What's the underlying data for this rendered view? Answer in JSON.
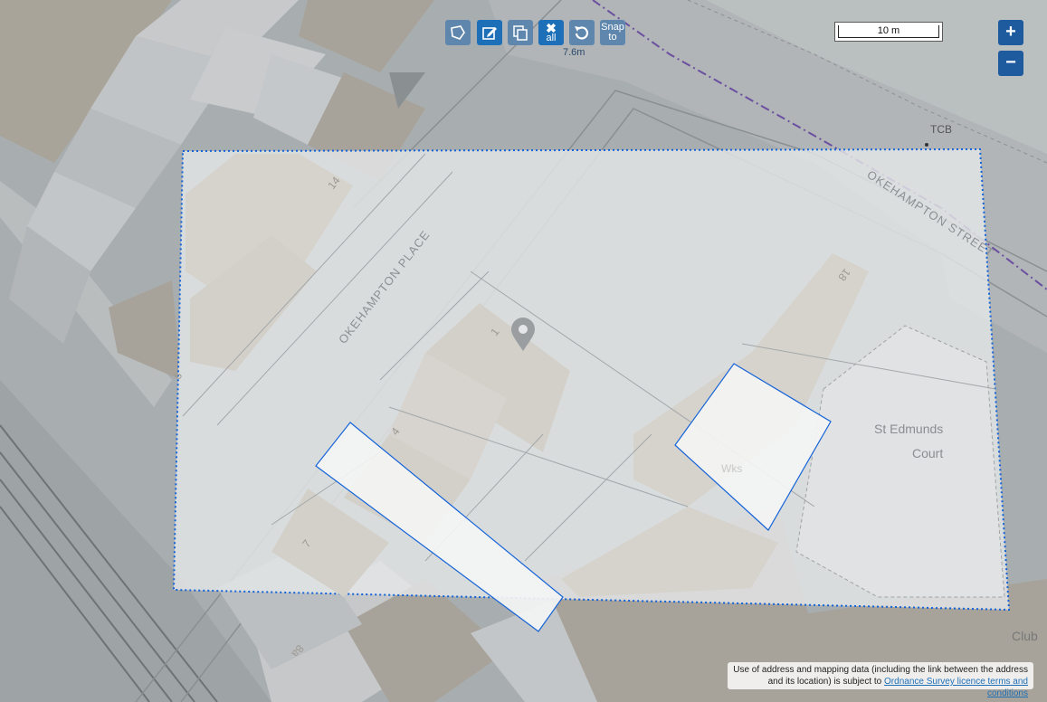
{
  "toolbar": {
    "draw_polygon_icon": "polygon-icon",
    "edit_icon": "edit-icon",
    "copy_icon": "copy-icon",
    "clear_all_label": "all",
    "clear_all_icon": "cross-icon",
    "undo_icon": "undo-icon",
    "snap_label_line1": "Snap",
    "snap_label_line2": "to",
    "area_readout": "7.6m"
  },
  "scale": {
    "label": "10 m"
  },
  "zoom": {
    "in_label": "+",
    "out_label": "−"
  },
  "map_labels": {
    "street_place": "OKEHAMPTON PLACE",
    "street_street": "OKEHAMPTON STREET",
    "tcb": "TCB",
    "st_edmunds_1": "St Edmunds",
    "st_edmunds_2": "Court",
    "club": "Club",
    "wks": "Wks",
    "house_14": "14",
    "house_1": "1",
    "house_4": "4",
    "house_7": "7",
    "house_18": "18",
    "house_8a": "8a",
    "house_5": "5"
  },
  "attribution": {
    "text_line1": "Use of address and mapping data (including the link between the address",
    "text_line2": "and its location) is subject to",
    "link_text": "Ordnance Survey licence terms and conditions"
  },
  "colors": {
    "button_blue": "#1d70b8",
    "boundary_blue": "#1463d8",
    "building_beige": "#c9c5bd"
  }
}
